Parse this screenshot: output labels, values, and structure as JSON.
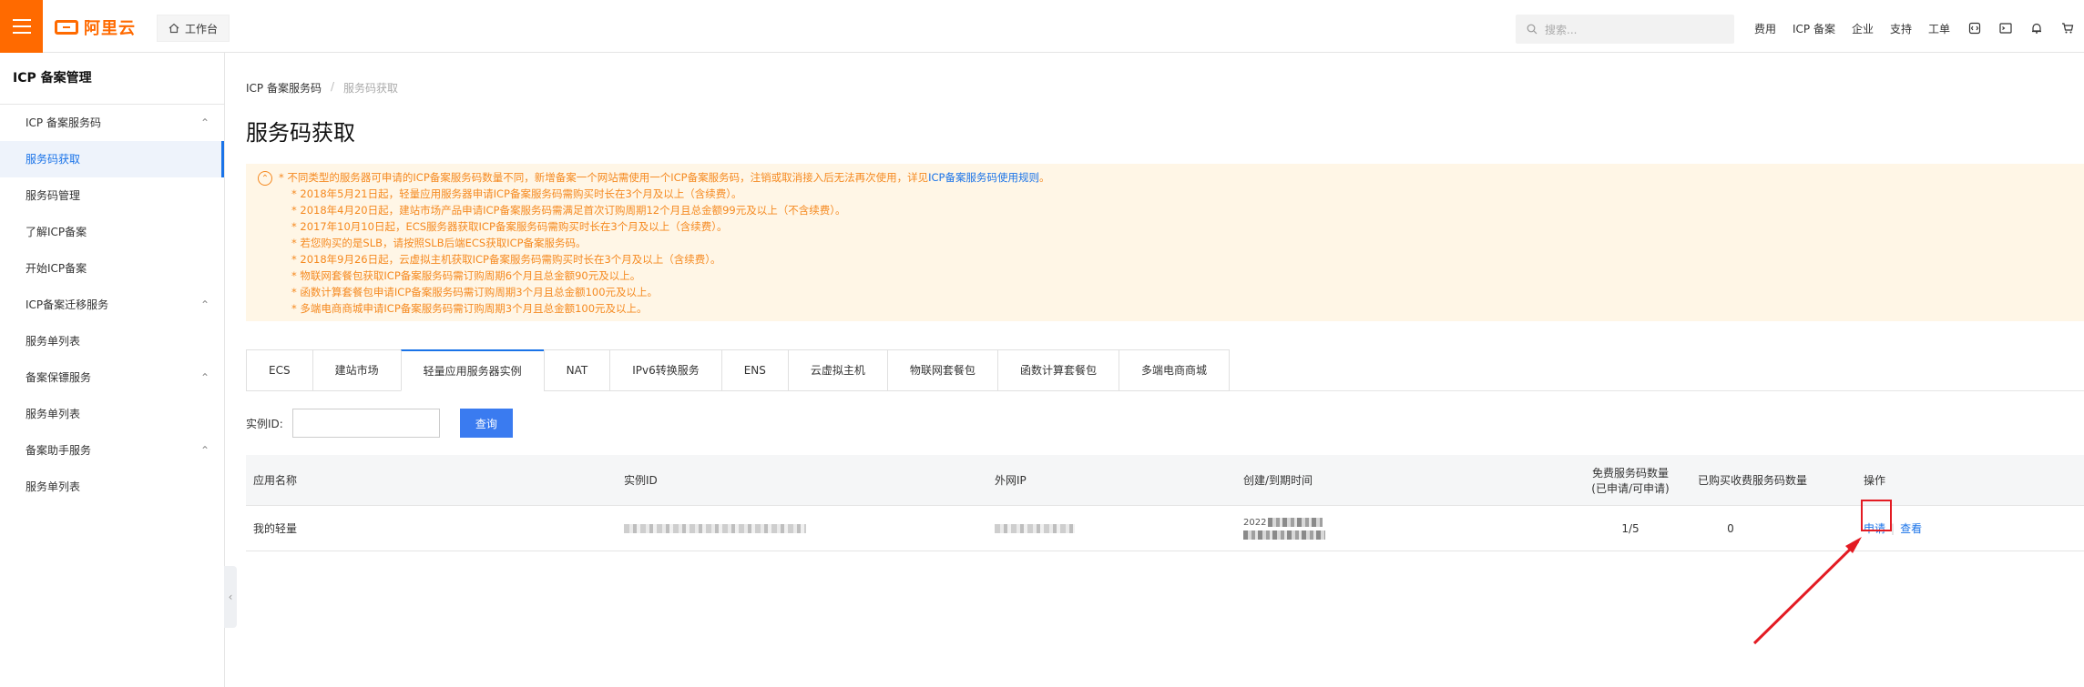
{
  "topbar": {
    "logo_text": "阿里云",
    "workbench_label": "工作台",
    "search_placeholder": "搜索...",
    "nav_items": [
      "费用",
      "ICP 备案",
      "企业",
      "支持",
      "工单"
    ],
    "icons": [
      "code-icon",
      "terminal-icon",
      "bell-icon",
      "cart-icon"
    ]
  },
  "sidebar": {
    "title": "ICP 备案管理",
    "items": [
      {
        "label": "ICP 备案服务码",
        "type": "group"
      },
      {
        "label": "服务码获取",
        "type": "item",
        "active": true
      },
      {
        "label": "服务码管理",
        "type": "item"
      },
      {
        "label": "了解ICP备案",
        "type": "item"
      },
      {
        "label": "开始ICP备案",
        "type": "item"
      },
      {
        "label": "ICP备案迁移服务",
        "type": "group"
      },
      {
        "label": "服务单列表",
        "type": "item"
      },
      {
        "label": "备案保镖服务",
        "type": "group"
      },
      {
        "label": "服务单列表",
        "type": "item"
      },
      {
        "label": "备案助手服务",
        "type": "group"
      },
      {
        "label": "服务单列表",
        "type": "item"
      }
    ]
  },
  "breadcrumb": [
    "ICP 备案服务码",
    "服务码获取"
  ],
  "page_title": "服务码获取",
  "notice": {
    "first": "* 不同类型的服务器可申请的ICP备案服务码数量不同，新增备案一个网站需使用一个ICP备案服务码，注销或取消接入后无法再次使用，详见",
    "first_link": "ICP备案服务码使用规则",
    "first_end": "。",
    "lines": [
      "* 2018年5月21日起，轻量应用服务器申请ICP备案服务码需购买时长在3个月及以上（含续费）。",
      "* 2018年4月20日起，建站市场产品申请ICP备案服务码需满足首次订购周期12个月且总金额99元及以上（不含续费）。",
      "* 2017年10月10日起，ECS服务器获取ICP备案服务码需购买时长在3个月及以上（含续费）。",
      "* 若您购买的是SLB，请按照SLB后端ECS获取ICP备案服务码。",
      "* 2018年9月26日起，云虚拟主机获取ICP备案服务码需购买时长在3个月及以上（含续费）。",
      "* 物联网套餐包获取ICP备案服务码需订购周期6个月且总金额90元及以上。",
      "* 函数计算套餐包申请ICP备案服务码需订购周期3个月且总金额100元及以上。",
      "* 多端电商商城申请ICP备案服务码需订购周期3个月且总金额100元及以上。"
    ]
  },
  "tabs": [
    {
      "label": "ECS"
    },
    {
      "label": "建站市场"
    },
    {
      "label": "轻量应用服务器实例",
      "active": true
    },
    {
      "label": "NAT"
    },
    {
      "label": "IPv6转换服务"
    },
    {
      "label": "ENS"
    },
    {
      "label": "云虚拟主机"
    },
    {
      "label": "物联网套餐包"
    },
    {
      "label": "函数计算套餐包"
    },
    {
      "label": "多端电商商城"
    }
  ],
  "filter": {
    "label": "实例ID:",
    "value": "",
    "placeholder": "",
    "button": "查询"
  },
  "table": {
    "headers": {
      "app_name": "应用名称",
      "instance_id": "实例ID",
      "public_ip": "外网IP",
      "time": "创建/到期时间",
      "free_codes_line1": "免费服务码数量",
      "free_codes_line2": "(已申请/可申请)",
      "purchased": "已购买收费服务码数量",
      "ops": "操作"
    },
    "rows": [
      {
        "app_name": "我的轻量",
        "time_prefix": "2022",
        "free_codes": "1/5",
        "purchased": "0",
        "op_apply": "申请",
        "op_view": "查看"
      }
    ]
  },
  "colors": {
    "accent": "#ff6a00",
    "link": "#1a73e8",
    "notice_text": "#f5891f",
    "highlight": "#e31b23"
  }
}
